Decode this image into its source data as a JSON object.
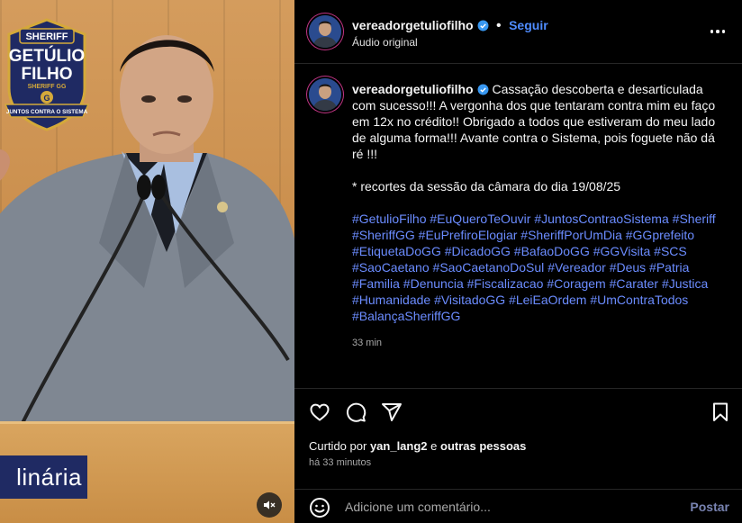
{
  "media": {
    "badge_top": "SHERIFF",
    "badge_name_1": "GETÚLIO",
    "badge_name_2": "FILHO",
    "badge_sub": "SHERIFF GG",
    "badge_letter": "G",
    "badge_ribbon": "JUNTOS CONTRA O SISTEMA",
    "caption": "linária",
    "mute_icon": "speaker-muted-icon"
  },
  "header": {
    "username": "vereadorgetuliofilho",
    "separator": "•",
    "follow_label": "Seguir",
    "audio_label": "Áudio original",
    "more_icon": "more-horizontal-icon"
  },
  "post": {
    "username": "vereadorgetuliofilho",
    "caption": "Cassação descoberta e desarticulada com sucesso!!! A vergonha dos que tentaram contra mim eu faço em 12x no crédito!! Obrigado a todos que estiveram do meu lado de alguma forma!!! Avante contra o Sistema, pois foguete não dá ré !!!",
    "note": "* recortes da sessão da câmara do dia 19/08/25",
    "hashtags": [
      "#GetulioFilho",
      "#EuQueroTeOuvir",
      "#JuntosContraoSistema",
      "#Sheriff",
      "#SheriffGG",
      "#EuPrefiroElogiar",
      "#SheriffPorUmDia",
      "#GGprefeito",
      "#EtiquetaDoGG",
      "#DicadoGG",
      "#BafaoDoGG",
      "#GGVisita",
      "#SCS",
      "#SaoCaetano",
      "#SaoCaetanoDoSul",
      "#Vereador",
      "#Deus",
      "#Patria",
      "#Familia",
      "#Denuncia",
      "#Fiscalizacao",
      "#Coragem",
      "#Carater",
      "#Justica",
      "#Humanidade",
      "#VisitadoGG",
      "#LeiEaOrdem",
      "#UmContraTodos",
      "#BalançaSheriffGG"
    ],
    "time": "33 min"
  },
  "likes": {
    "prefix": "Curtido por",
    "user": "yan_lang2",
    "and": "e",
    "others": "outras pessoas",
    "ago": "há 33 minutos"
  },
  "comment_box": {
    "placeholder": "Adicione um comentário...",
    "post_label": "Postar"
  },
  "colors": {
    "link": "#4f8cff",
    "hashtag": "#6b8cff",
    "badge_navy": "#1f2a63",
    "badge_gold": "#d4a93a"
  }
}
